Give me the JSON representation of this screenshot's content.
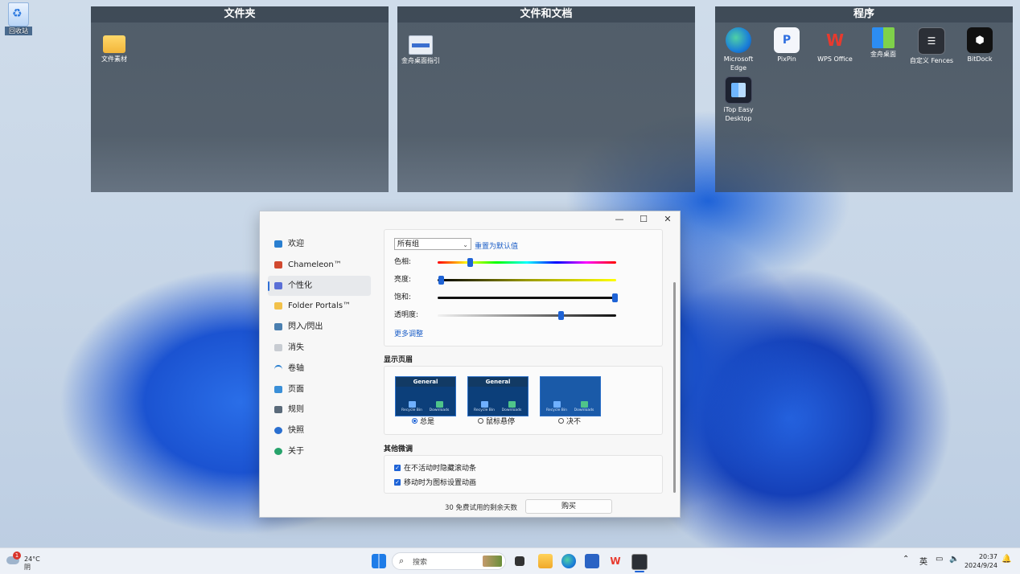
{
  "desktop": {
    "recycle_bin_label": "回收站"
  },
  "fences": [
    {
      "title": "文件夹",
      "items": [
        {
          "label": "文件素材",
          "icon": "folder-icon"
        }
      ]
    },
    {
      "title": "文件和文档",
      "items": [
        {
          "label": "金舟桌面指引",
          "icon": "document-icon"
        }
      ]
    },
    {
      "title": "程序",
      "items": [
        {
          "label": "Microsoft Edge",
          "icon": "edge-icon"
        },
        {
          "label": "PixPin",
          "icon": "pixpin-icon"
        },
        {
          "label": "WPS Office",
          "icon": "wps-icon"
        },
        {
          "label": "金舟桌面",
          "icon": "jinzhou-desktop-icon"
        },
        {
          "label": "自定义 Fences",
          "icon": "fences-icon"
        },
        {
          "label": "BitDock",
          "icon": "bitdock-icon"
        },
        {
          "label": "iTop Easy Desktop",
          "icon": "itop-icon"
        }
      ]
    }
  ],
  "window": {
    "caption": {
      "minimize": "—",
      "maximize": "☐",
      "close": "✕"
    },
    "nav": [
      {
        "label": "欢迎",
        "icon": "monitor-icon",
        "active": false
      },
      {
        "label": "Chameleon™",
        "icon": "chameleon-icon",
        "active": false
      },
      {
        "label": "个性化",
        "icon": "personalize-icon",
        "active": true
      },
      {
        "label": "Folder Portals™",
        "icon": "folder-icon",
        "active": false
      },
      {
        "label": "閃入/閃出",
        "icon": "flash-icon",
        "active": false
      },
      {
        "label": "消失",
        "icon": "vanish-icon",
        "active": false
      },
      {
        "label": "卷轴",
        "icon": "scroll-icon",
        "active": false
      },
      {
        "label": "页面",
        "icon": "pages-icon",
        "active": false
      },
      {
        "label": "规则",
        "icon": "rules-icon",
        "active": false
      },
      {
        "label": "快照",
        "icon": "snapshot-icon",
        "active": false
      },
      {
        "label": "关于",
        "icon": "about-icon",
        "active": false
      }
    ],
    "color_card": {
      "group_select": "所有组",
      "reset_link": "重置为默认值",
      "sliders": [
        {
          "label": "色相:",
          "value": 0.18
        },
        {
          "label": "亮度:",
          "value": 0.02
        },
        {
          "label": "饱和:",
          "value": 0.99
        },
        {
          "label": "透明度:",
          "value": 0.69
        }
      ],
      "more_link": "更多调整"
    },
    "header_section": {
      "title": "显示页眉",
      "preview_header": "General",
      "preview_items": [
        "Recycle Bin",
        "Downloads"
      ],
      "options": [
        {
          "label": "总是",
          "selected": true
        },
        {
          "label": "鼠标悬停",
          "selected": false
        },
        {
          "label": "决不",
          "selected": false
        }
      ]
    },
    "tweaks_section": {
      "title": "其他微调",
      "options": [
        {
          "label": "在不活动时隐藏滚动条",
          "checked": true
        },
        {
          "label": "移动时为图标设置动画",
          "checked": true
        }
      ]
    },
    "footer": {
      "trial_text": "30 免费试用的剩余天数",
      "buy_label": "购买"
    }
  },
  "taskbar": {
    "weather": {
      "badge": "1",
      "temp": "24°C",
      "condition": "阴"
    },
    "search_placeholder": "搜索",
    "tray": {
      "language": "英",
      "time": "20:37",
      "date": "2024/9/24"
    }
  }
}
